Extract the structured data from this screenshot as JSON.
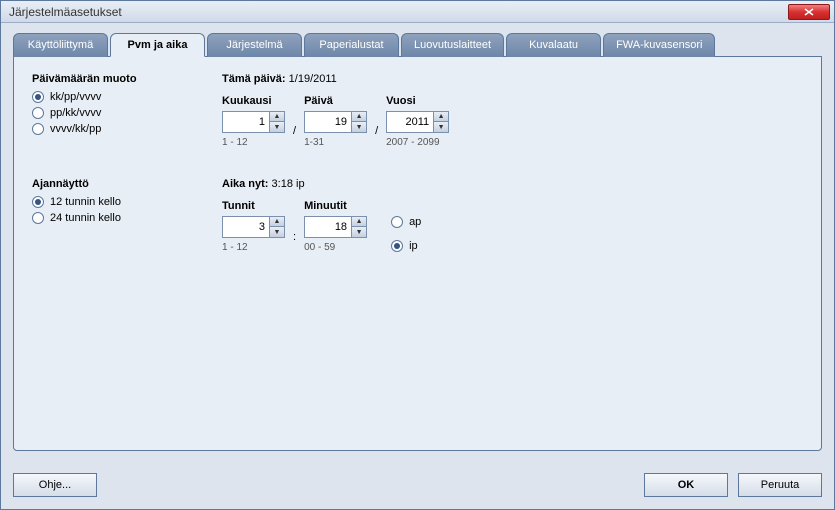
{
  "window": {
    "title": "Järjestelmäasetukset"
  },
  "tabs": [
    {
      "label": "Käyttöliittymä"
    },
    {
      "label": "Pvm ja aika"
    },
    {
      "label": "Järjestelmä"
    },
    {
      "label": "Paperialustat"
    },
    {
      "label": "Luovutuslaitteet"
    },
    {
      "label": "Kuvalaatu"
    },
    {
      "label": "FWA-kuvasensori"
    }
  ],
  "dateFormat": {
    "heading": "Päivämäärän muoto",
    "options": [
      {
        "label": "kk/pp/vvvv"
      },
      {
        "label": "pp/kk/vvvv"
      },
      {
        "label": "vvvv/kk/pp"
      }
    ]
  },
  "today": {
    "label": "Tämä päivä:",
    "value": "1/19/2011",
    "month": {
      "label": "Kuukausi",
      "value": "1",
      "range": "1 - 12"
    },
    "day": {
      "label": "Päivä",
      "value": "19",
      "range": "1-31"
    },
    "year": {
      "label": "Vuosi",
      "value": "2011",
      "range": "2007 - 2099"
    },
    "sep": "/"
  },
  "timeDisplay": {
    "heading": "Ajannäyttö",
    "options": [
      {
        "label": "12 tunnin kello"
      },
      {
        "label": "24 tunnin kello"
      }
    ]
  },
  "timeNow": {
    "label": "Aika nyt:",
    "value": "3:18 ip",
    "hours": {
      "label": "Tunnit",
      "value": "3",
      "range": "1 - 12"
    },
    "minutes": {
      "label": "Minuutit",
      "value": "18",
      "range": "00 - 59"
    },
    "sep": ":",
    "meridiem": {
      "am": "ap",
      "pm": "ip"
    }
  },
  "buttons": {
    "help": "Ohje...",
    "ok": "OK",
    "cancel": "Peruuta"
  }
}
